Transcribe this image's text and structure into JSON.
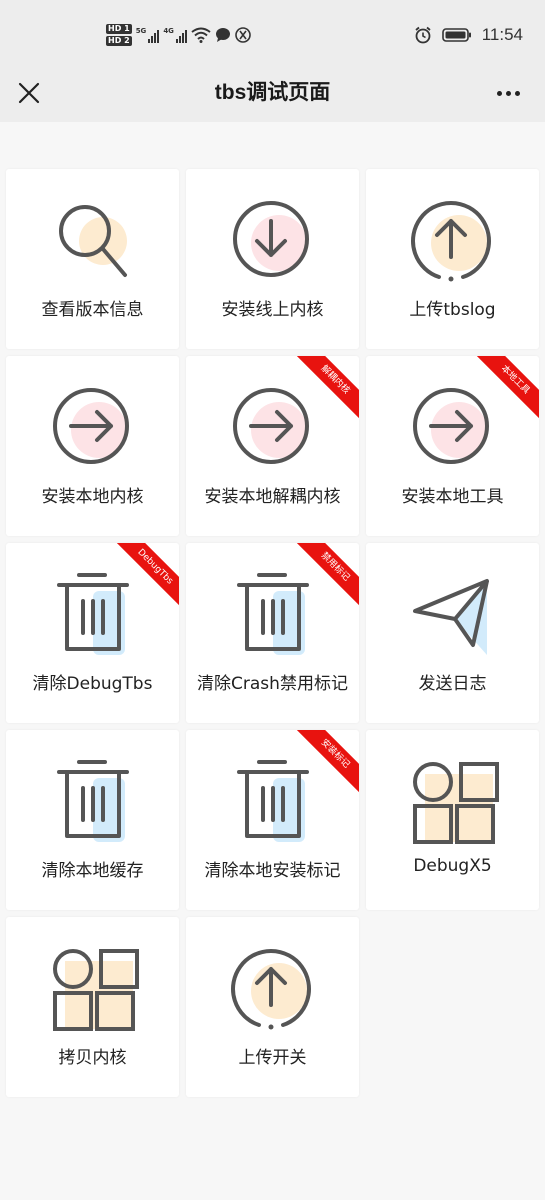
{
  "status_bar": {
    "hd1": "HD 1",
    "hd2": "HD 2",
    "sig1_label": "5G",
    "sig2_label": "4G",
    "time": "11:54"
  },
  "nav": {
    "title": "tbs调试页面"
  },
  "tiles": [
    {
      "label": "查看版本信息",
      "icon": "search-icon",
      "badge": null
    },
    {
      "label": "安装线上内核",
      "icon": "download-circle-icon",
      "badge": null
    },
    {
      "label": "上传tbslog",
      "icon": "upload-circle-icon",
      "badge": null
    },
    {
      "label": "安装本地内核",
      "icon": "arrow-right-circle-icon",
      "badge": null
    },
    {
      "label": "安装本地解耦内核",
      "icon": "arrow-right-circle-icon",
      "badge": "解耦内核"
    },
    {
      "label": "安装本地工具",
      "icon": "arrow-right-circle-icon",
      "badge": "本地工具"
    },
    {
      "label": "清除DebugTbs",
      "icon": "trash-icon",
      "badge": "DebugTbs"
    },
    {
      "label": "清除Crash禁用标记",
      "icon": "trash-icon",
      "badge": "禁用标记"
    },
    {
      "label": "发送日志",
      "icon": "paper-plane-icon",
      "badge": null
    },
    {
      "label": "清除本地缓存",
      "icon": "trash-icon",
      "badge": null
    },
    {
      "label": "清除本地安装标记",
      "icon": "trash-icon",
      "badge": "安装标记"
    },
    {
      "label": "DebugX5",
      "icon": "grid-apps-icon",
      "badge": null
    },
    {
      "label": "拷贝内核",
      "icon": "grid-apps-icon",
      "badge": null
    },
    {
      "label": "上传开关",
      "icon": "upload-circle-icon",
      "badge": null
    }
  ],
  "colors": {
    "pink": "#fde3e6",
    "peach": "#fdebd0",
    "blue": "#d2ebfb",
    "stroke": "#555555",
    "ribbon": "#e8130f"
  }
}
